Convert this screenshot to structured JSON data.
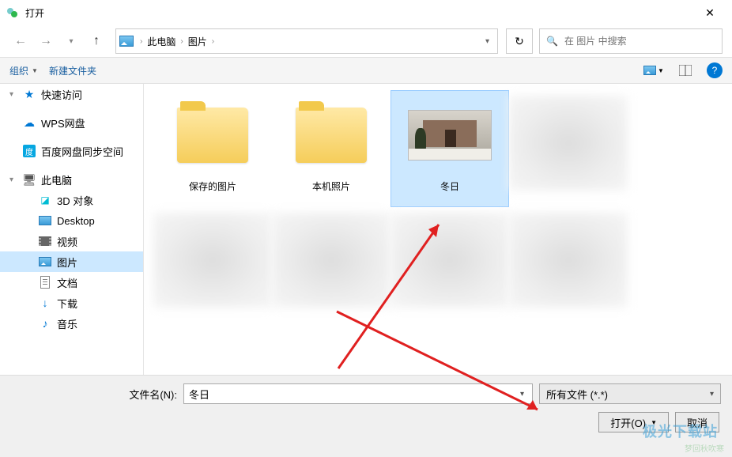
{
  "window": {
    "title": "打开"
  },
  "nav": {
    "breadcrumb": [
      "此电脑",
      "图片"
    ],
    "search_placeholder": "在 图片 中搜索"
  },
  "toolbar": {
    "organize": "组织",
    "newfolder": "新建文件夹"
  },
  "sidebar": {
    "items": [
      {
        "label": "快速访问",
        "icon": "star",
        "level": 1,
        "chevron": "▾"
      },
      {
        "label": "WPS网盘",
        "icon": "cloud",
        "level": 1,
        "chevron": ""
      },
      {
        "label": "百度网盘同步空间",
        "icon": "baidu",
        "level": 1,
        "chevron": ""
      },
      {
        "label": "此电脑",
        "icon": "pc",
        "level": 1,
        "chevron": "▾"
      },
      {
        "label": "3D 对象",
        "icon": "3d",
        "level": 2,
        "chevron": ""
      },
      {
        "label": "Desktop",
        "icon": "desktop",
        "level": 2,
        "chevron": ""
      },
      {
        "label": "视频",
        "icon": "video",
        "level": 2,
        "chevron": ""
      },
      {
        "label": "图片",
        "icon": "pic",
        "level": 2,
        "chevron": "",
        "selected": true
      },
      {
        "label": "文档",
        "icon": "doc",
        "level": 2,
        "chevron": ""
      },
      {
        "label": "下载",
        "icon": "dl",
        "level": 2,
        "chevron": ""
      },
      {
        "label": "音乐",
        "icon": "music",
        "level": 2,
        "chevron": ""
      }
    ]
  },
  "files": {
    "items": [
      {
        "label": "保存的图片",
        "kind": "folder"
      },
      {
        "label": "本机照片",
        "kind": "folder"
      },
      {
        "label": "冬日",
        "kind": "image",
        "selected": true
      },
      {
        "label": "",
        "kind": "blur"
      },
      {
        "label": "",
        "kind": "blur"
      },
      {
        "label": "",
        "kind": "blur"
      },
      {
        "label": "",
        "kind": "blur"
      },
      {
        "label": "",
        "kind": "blur"
      }
    ]
  },
  "bottom": {
    "fname_label": "文件名(N):",
    "fname_value": "冬日",
    "ftype_value": "所有文件 (*.*)",
    "open_label": "打开(O)",
    "cancel_label": "取消"
  },
  "watermark": {
    "main": "极光下载站",
    "sub": "梦回秋吹寒"
  }
}
